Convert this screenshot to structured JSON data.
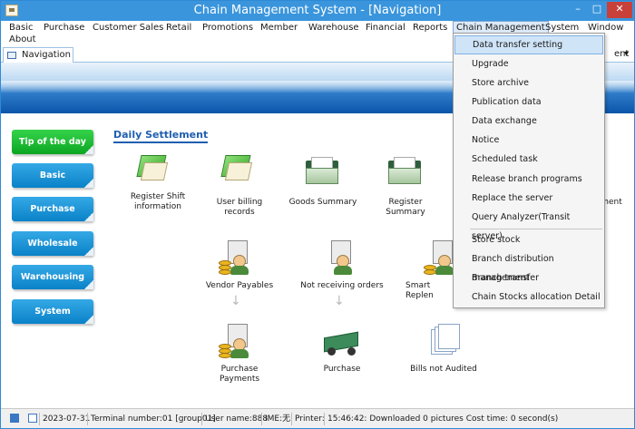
{
  "window": {
    "title": "Chain Management System - [Navigation]",
    "min_glyph": "–",
    "max_glyph": "□",
    "close_glyph": "✕"
  },
  "menu": [
    "Basic",
    "Purchase",
    "Customer Sales",
    "Retail",
    "Promotions",
    "Member",
    "Warehouse",
    "Financial",
    "Reports",
    "Chain Management",
    "System",
    "Window",
    "About"
  ],
  "tab": {
    "label": "Navigation",
    "right_text": "ent",
    "right_arrow": "▾"
  },
  "sidebar": [
    "Tip of the day",
    "Basic",
    "Purchase",
    "Wholesale",
    "Warehousing",
    "System"
  ],
  "section_title": "Daily Settlement",
  "items": {
    "register_shift": "Register Shift information",
    "user_billing": "User billing records",
    "goods_summary": "Goods Summary",
    "register_summary": "Register Summary",
    "right_clip": "ment",
    "vendor_payables": "Vendor Payables",
    "not_receiving": "Not receiving orders",
    "smart_replen": "Smart Replen",
    "purchase_payments": "Purchase Payments",
    "purchase": "Purchase",
    "bills_not_audited": "Bills not Audited"
  },
  "dropdown": {
    "group1": [
      "Data transfer setting",
      "Upgrade",
      "Store archive",
      "Publication data",
      "Data exchange",
      "Notice",
      "Scheduled task",
      "Release branch programs",
      "Replace the server",
      "Query Analyzer(Transit server)"
    ],
    "group2": [
      "Store stock",
      "Branch distribution management",
      "Branch transfer",
      "Chain Stocks allocation Detail"
    ]
  },
  "statusbar": {
    "date": "2023-07-31",
    "terminal": "Terminal number:01 [group01]",
    "user": "User name:888",
    "ime": "IME:无",
    "printer": "Printer:",
    "message": "15:46:42: Downloaded 0 pictures Cost time: 0 second(s)"
  },
  "colors": {
    "titlebar": "#3a95dc",
    "section_title": "#1f5fb0",
    "sidebar_blue": "#0a82c8",
    "sidebar_green": "#0ca622",
    "highlight": "#cfe4f7"
  }
}
